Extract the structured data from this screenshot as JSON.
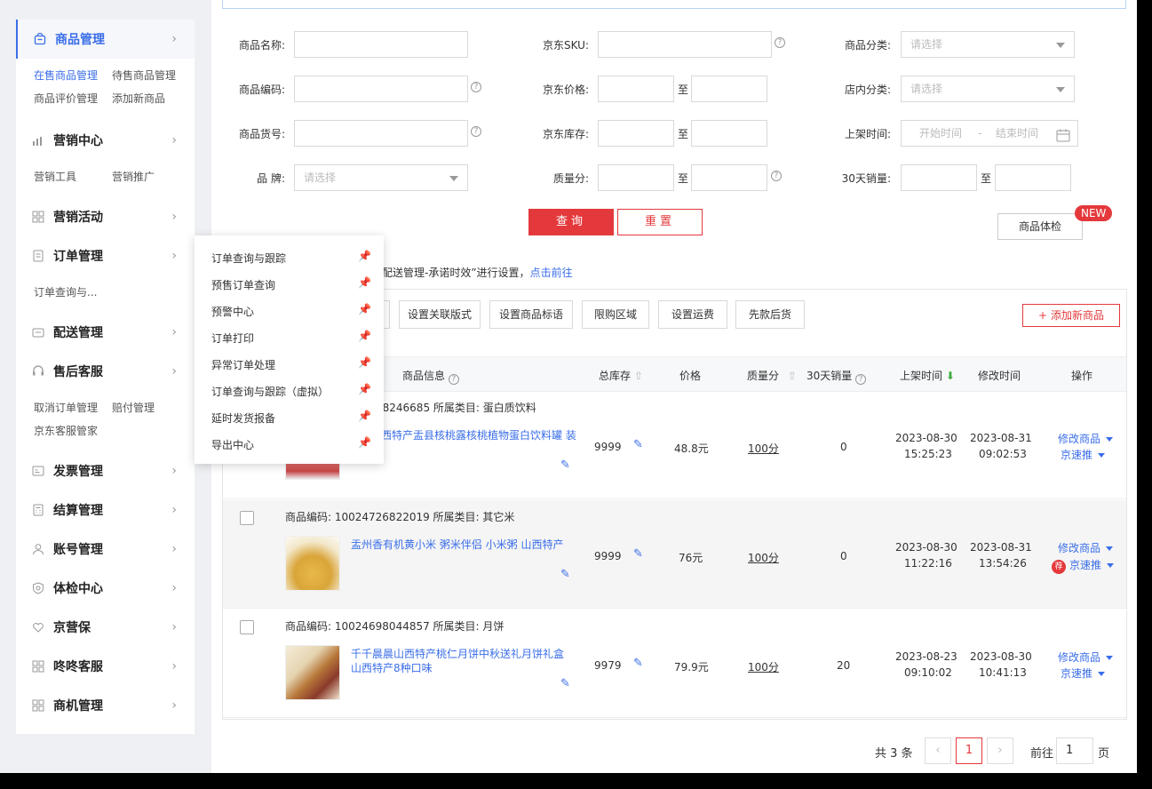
{
  "sidebar": {
    "product_mgmt": {
      "label": "商品管理",
      "subs": [
        "在售商品管理",
        "待售商品管理",
        "商品评价管理",
        "添加新商品"
      ]
    },
    "marketing_center": {
      "label": "营销中心",
      "subs": [
        "营销工具",
        "营销推广"
      ]
    },
    "marketing_events": {
      "label": "营销活动"
    },
    "order_mgmt": {
      "label": "订单管理",
      "subs": [
        "订单查询与..."
      ]
    },
    "delivery_mgmt": {
      "label": "配送管理"
    },
    "after_sales": {
      "label": "售后客服",
      "subs": [
        "取消订单管理",
        "赔付管理",
        "京东客服管家"
      ]
    },
    "invoice_mgmt": {
      "label": "发票管理"
    },
    "settlement_mgmt": {
      "label": "结算管理"
    },
    "account_mgmt": {
      "label": "账号管理"
    },
    "health_center": {
      "label": "体检中心"
    },
    "jingyingbao": {
      "label": "京营保"
    },
    "dongdong": {
      "label": "咚咚客服"
    },
    "opportunity": {
      "label": "商机管理"
    }
  },
  "dropdown": {
    "items": [
      "订单查询与跟踪",
      "预售订单查询",
      "预警中心",
      "订单打印",
      "异常订单处理",
      "订单查询与跟踪（虚拟）",
      "延时发货报备",
      "导出中心"
    ]
  },
  "filters": {
    "product_name": "商品名称:",
    "jd_sku": "京东SKU:",
    "category": "商品分类:",
    "product_code": "商品编码:",
    "jd_price": "京东价格:",
    "shop_category": "店内分类:",
    "item_no": "商品货号:",
    "jd_stock": "京东库存:",
    "list_time": "上架时间:",
    "brand": "品 牌:",
    "quality": "质量分:",
    "sales30": "30天销量:",
    "to": "至",
    "please_select": "请选择",
    "start_time": "开始时间",
    "dash": "-",
    "end_time": "结束时间",
    "search_btn": "查询",
    "reset_btn": "重置",
    "check_btn": "商品体检",
    "new_badge": "NEW"
  },
  "notice": {
    "text": "配送管理-承诺时效”进行设置，",
    "link": "点击前往"
  },
  "toolbar": {
    "btn1": "设置关联版式",
    "btn2": "设置商品标语",
    "btn3": "限购区域",
    "btn4": "设置运费",
    "btn5": "先款后货",
    "add": "添加新商品",
    "add_plus": "+"
  },
  "table": {
    "headers": {
      "info": "商品信息",
      "stock": "总库存",
      "price": "价格",
      "quality": "质量分",
      "sales": "30天销量",
      "list_time": "上架时间",
      "modify_time": "修改时间",
      "ops": "操作"
    },
    "rows": [
      {
        "meta": "28246685  所属类目: 蛋白质饮料",
        "name": "西特产盂县核桃露核桃植物蛋白饮料罐 装",
        "stock": "9999",
        "price": "48.8元",
        "quality": "100分",
        "sales": "0",
        "list_date": "2023-08-30",
        "list_clock": "15:25:23",
        "mod_date": "2023-08-31",
        "mod_clock": "09:02:53",
        "op1": "修改商品",
        "op2": "京速推"
      },
      {
        "meta": "商品编码:  10024726822019  所属类目: 其它米",
        "name": "盂州香有机黄小米 粥米伴侣 小米粥 山西特产",
        "stock": "9999",
        "price": "76元",
        "quality": "100分",
        "sales": "0",
        "list_date": "2023-08-30",
        "list_clock": "11:22:16",
        "mod_date": "2023-08-31",
        "mod_clock": "13:54:26",
        "op1": "修改商品",
        "op2": "京速推",
        "rec": "荐"
      },
      {
        "meta": "商品编码:  10024698044857  所属类目: 月饼",
        "name": "千千晨晨山西特产桃仁月饼中秋送礼月饼礼盒 山西特产8种口味",
        "stock": "9979",
        "price": "79.9元",
        "quality": "100分",
        "sales": "20",
        "list_date": "2023-08-23",
        "list_clock": "09:10:02",
        "mod_date": "2023-08-30",
        "mod_clock": "10:41:13",
        "op1": "修改商品",
        "op2": "京速推"
      }
    ]
  },
  "pagination": {
    "total": "共 3 条",
    "prev": "‹",
    "current": "1",
    "next": "›",
    "goto": "前往",
    "page_input": "1",
    "page_unit": "页"
  },
  "colors": {
    "accent": "#3a6ee8",
    "brand_red": "#e4393c"
  },
  "icons": [
    "bag-icon",
    "chart-icon",
    "grid-icon",
    "doc-icon",
    "truck-icon",
    "headset-icon",
    "invoice-icon",
    "calc-icon",
    "user-icon",
    "shield-icon",
    "heart-icon",
    "pin-icon",
    "pencil-icon",
    "calendar-icon",
    "help-icon",
    "sort-icon"
  ]
}
